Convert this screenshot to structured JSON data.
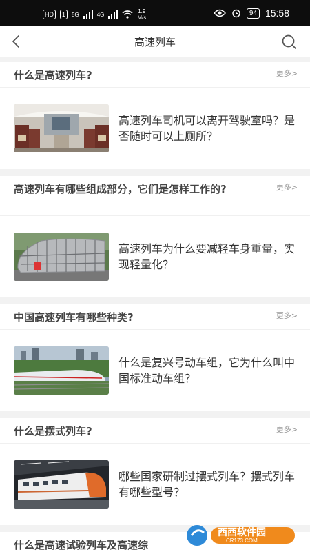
{
  "status_bar": {
    "network_badges": [
      "HD",
      "1",
      "5G",
      "4G"
    ],
    "speed_value": "1.9",
    "speed_unit": "M/s",
    "battery": "94",
    "time": "15:58"
  },
  "header": {
    "title": "高速列车",
    "back_icon": "chevron-left-icon",
    "search_icon": "search-icon"
  },
  "sections": [
    {
      "title": "什么是高速列车?",
      "more": "更多>",
      "article": {
        "title": "高速列车司机可以离开驾驶室吗？是否随时可以上厕所？",
        "image": "train-interior"
      }
    },
    {
      "title": "高速列车有哪些组成部分，它们是怎样工作的?",
      "more": "更多>",
      "article": {
        "title": "高速列车为什么要减轻车身重量，实现轻量化？",
        "image": "train-frame"
      }
    },
    {
      "title": "中国高速列车有哪些种类?",
      "more": "更多>",
      "article": {
        "title": "什么是复兴号动车组，它为什么叫中国标准动车组？",
        "image": "fuxing-train"
      }
    },
    {
      "title": "什么是摆式列车?",
      "more": "更多>",
      "article": {
        "title": "哪些国家研制过摆式列车？摆式列车有哪些型号？",
        "image": "tilting-train"
      }
    },
    {
      "title": "什么是高速试验列车及高速综",
      "more": ""
    }
  ],
  "watermark": {
    "brand": "西西软件园",
    "url": "CR173.COM"
  },
  "colors": {
    "status_bar_bg": "#0d0d0d",
    "page_bg": "#f2f2f2",
    "card_bg": "#ffffff",
    "title_text": "#444444",
    "more_text": "#999999"
  }
}
